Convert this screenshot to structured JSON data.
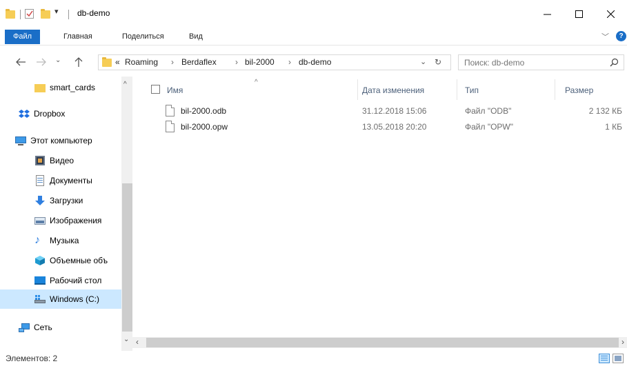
{
  "window": {
    "title": "db-demo"
  },
  "ribbon": {
    "tabs": [
      "Файл",
      "Главная",
      "Поделиться",
      "Вид"
    ]
  },
  "address": {
    "overflow": "«",
    "crumbs": [
      "Roaming",
      "Berdaflex",
      "bil-2000",
      "db-demo"
    ]
  },
  "search": {
    "placeholder": "Поиск: db-demo"
  },
  "nav": {
    "items": [
      {
        "label": "smart_cards",
        "icon": "folder-icon"
      },
      {
        "label": "Dropbox",
        "icon": "dropbox-icon"
      },
      {
        "label": "Этот компьютер",
        "icon": "computer-icon"
      },
      {
        "label": "Видео",
        "icon": "video-icon"
      },
      {
        "label": "Документы",
        "icon": "documents-icon"
      },
      {
        "label": "Загрузки",
        "icon": "downloads-icon"
      },
      {
        "label": "Изображения",
        "icon": "pictures-icon"
      },
      {
        "label": "Музыка",
        "icon": "music-icon"
      },
      {
        "label": "Объемные объ",
        "icon": "3d-objects-icon"
      },
      {
        "label": "Рабочий стол",
        "icon": "desktop-icon"
      },
      {
        "label": "Windows (C:)",
        "icon": "drive-icon"
      },
      {
        "label": "Сеть",
        "icon": "network-icon"
      }
    ]
  },
  "columns": {
    "name": "Имя",
    "date": "Дата изменения",
    "type": "Тип",
    "size": "Размер"
  },
  "files": [
    {
      "name": "bil-2000.odb",
      "date": "31.12.2018 15:06",
      "type": "Файл \"ODB\"",
      "size": "2 132 КБ"
    },
    {
      "name": "bil-2000.opw",
      "date": "13.05.2018 20:20",
      "type": "Файл \"OPW\"",
      "size": "1 КБ"
    }
  ],
  "status": {
    "text": "Элементов: 2"
  },
  "colors": {
    "accent": "#1a6ec7",
    "selection": "#cce8ff",
    "folder": "#f6cd56"
  }
}
